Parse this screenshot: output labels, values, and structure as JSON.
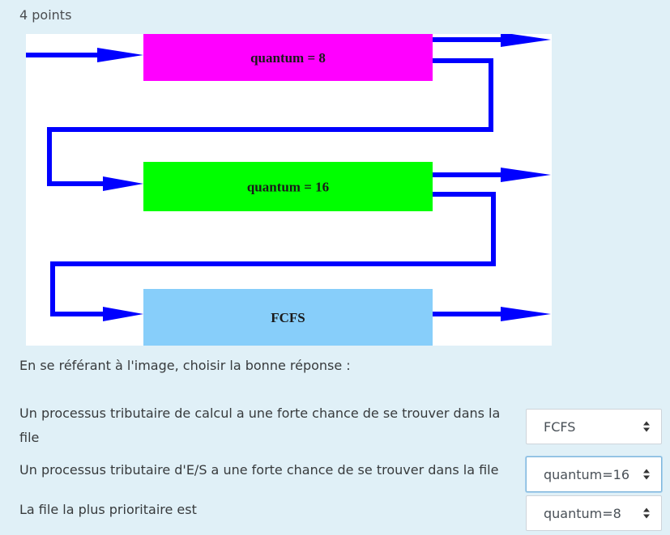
{
  "points_label": "4 points",
  "diagram": {
    "queues": [
      {
        "label": "quantum = 8",
        "color": "#ff00ff"
      },
      {
        "label": "quantum = 16",
        "color": "#00ff00"
      },
      {
        "label": "FCFS",
        "color": "#87cefa"
      }
    ],
    "arrow_color": "#0000ff"
  },
  "prompt": "En se référant à l'image, choisir la bonne réponse :",
  "questions": [
    {
      "text": "Un processus tributaire de calcul a une forte chance de se trouver dans la file",
      "selected": "FCFS"
    },
    {
      "text": "Un processus tributaire d'E/S a une forte chance de se trouver dans la file",
      "selected": "quantum=16"
    },
    {
      "text": "La file la plus prioritaire est",
      "selected": "quantum=8"
    }
  ]
}
